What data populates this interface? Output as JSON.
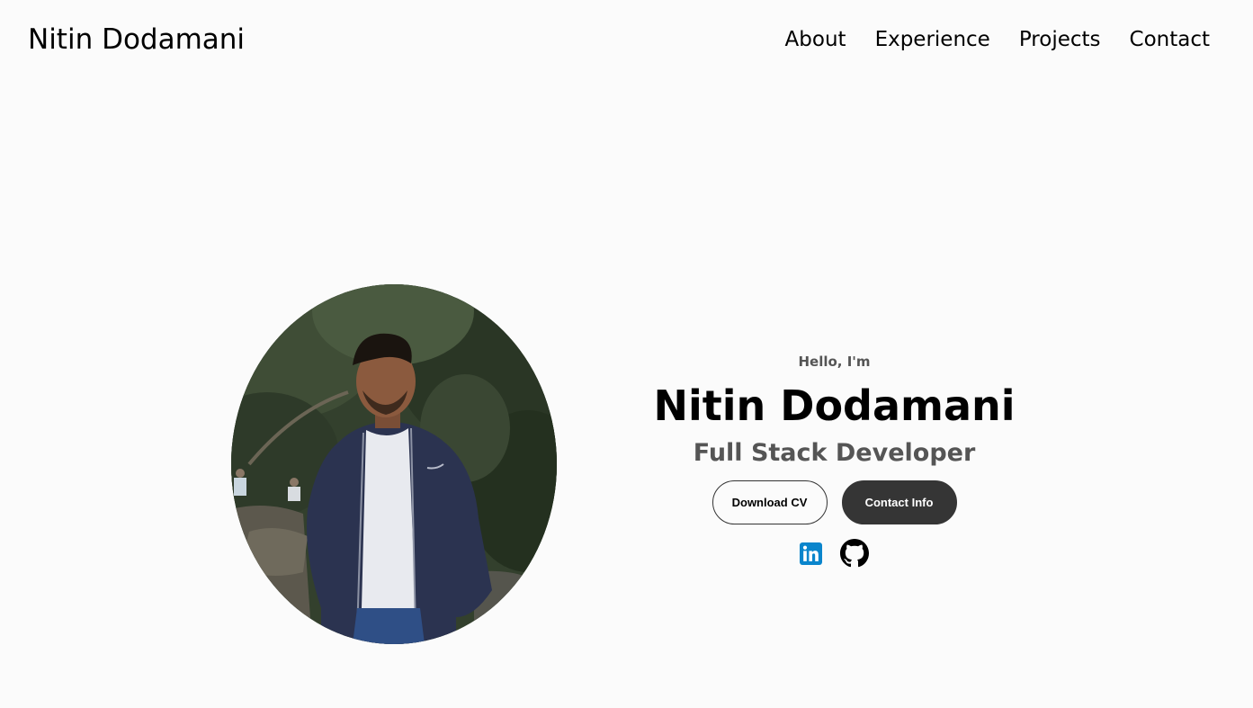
{
  "nav": {
    "logo": "Nitin Dodamani",
    "links": [
      {
        "label": "About"
      },
      {
        "label": "Experience"
      },
      {
        "label": "Projects"
      },
      {
        "label": "Contact"
      }
    ]
  },
  "hero": {
    "greeting": "Hello, I'm",
    "name": "Nitin Dodamani",
    "title": "Full Stack Developer",
    "buttons": {
      "download_cv": "Download CV",
      "contact_info": "Contact Info"
    },
    "socials": [
      {
        "icon": "linkedin-icon",
        "color": "#0a85cc"
      },
      {
        "icon": "github-icon",
        "color": "#000000"
      }
    ]
  },
  "photo": {
    "alt": "profile picture"
  },
  "colors": {
    "background": "#fbfbfb",
    "text_primary": "#000000",
    "text_secondary": "#555555",
    "button_dark": "#353535",
    "linkedin_blue": "#0a85cc"
  }
}
